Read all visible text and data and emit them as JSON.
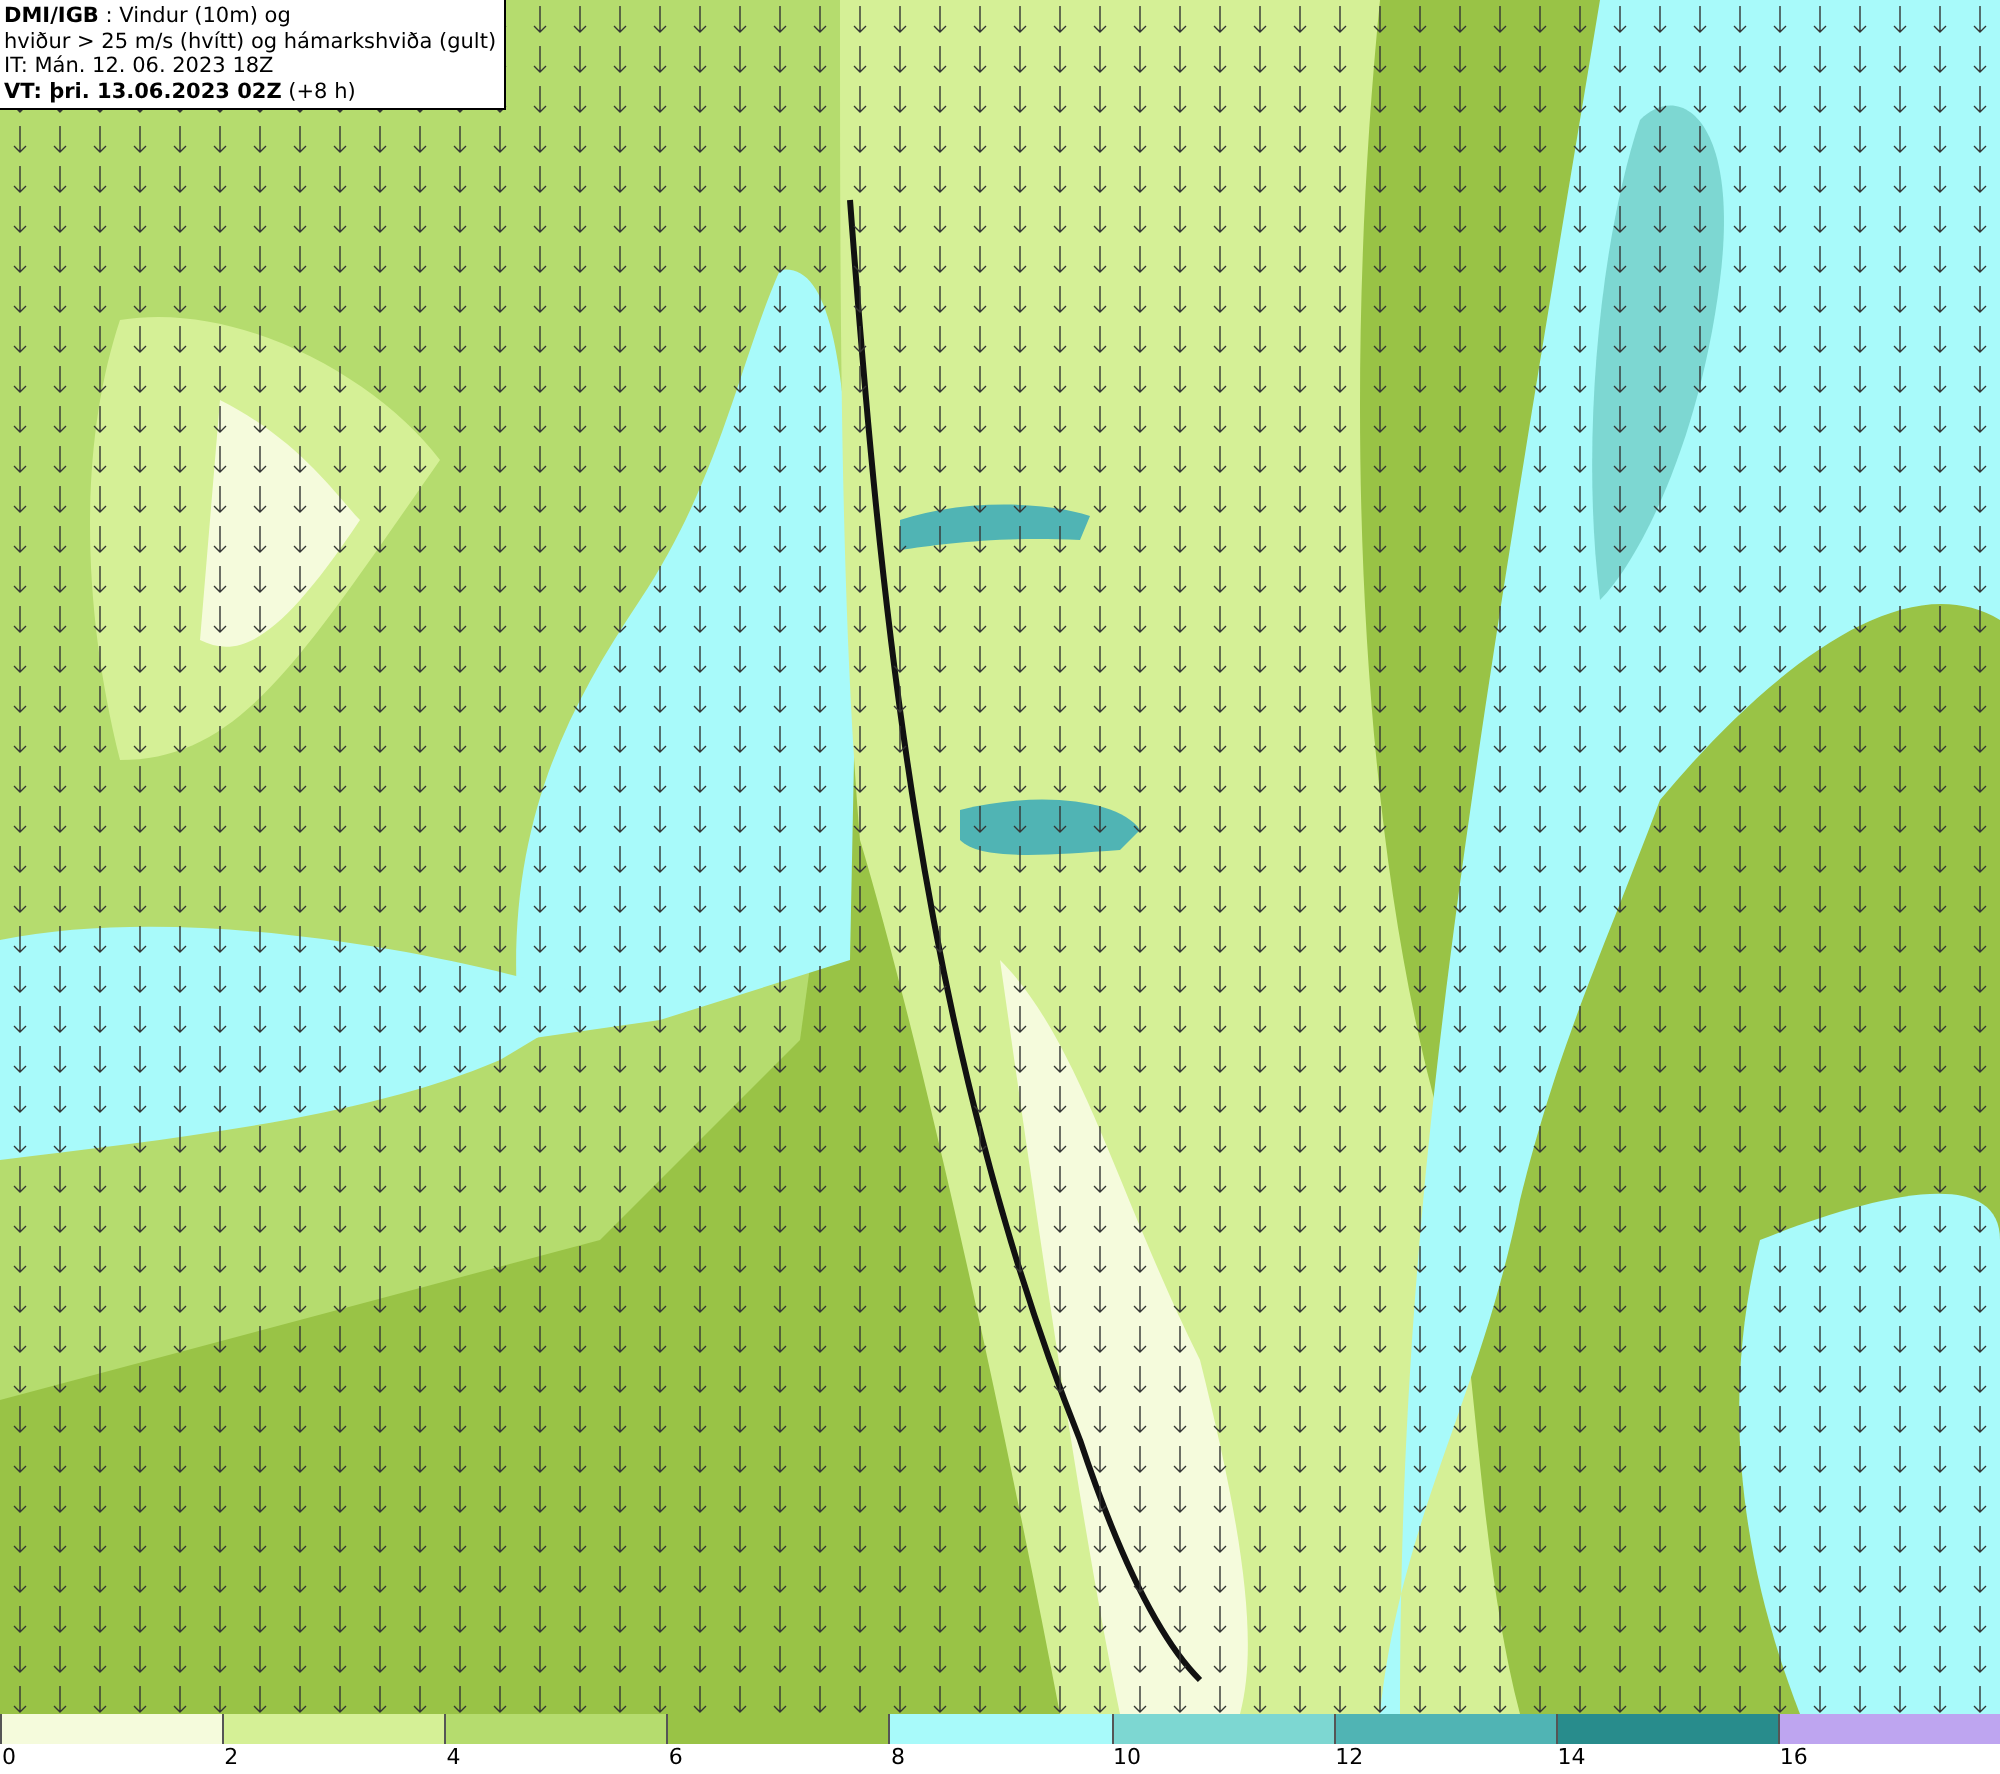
{
  "header": {
    "lines": [
      "**DMI/IGB** : Vindur (10m) og",
      "hviður > 25 m/s (hvítt) og hámarkshviða (gult)",
      "IT: Mán. 12. 06. 2023 18Z",
      "**VT: þri. 13.06.2023 02Z** (+8 h)"
    ]
  },
  "legend": [
    {
      "color": "#f5fbdc",
      "label": "0"
    },
    {
      "color": "#d5f096",
      "label": "2"
    },
    {
      "color": "#b5dc6e",
      "label": "4"
    },
    {
      "color": "#99c346",
      "label": "6"
    },
    {
      "color": "#a8fafa",
      "label": "8"
    },
    {
      "color": "#7dd7d2",
      "label": "10"
    },
    {
      "color": "#50b4b4",
      "label": "12"
    },
    {
      "color": "#288c8c",
      "label": "14"
    },
    {
      "color": "#bea5f0",
      "label": "16"
    }
  ]
}
